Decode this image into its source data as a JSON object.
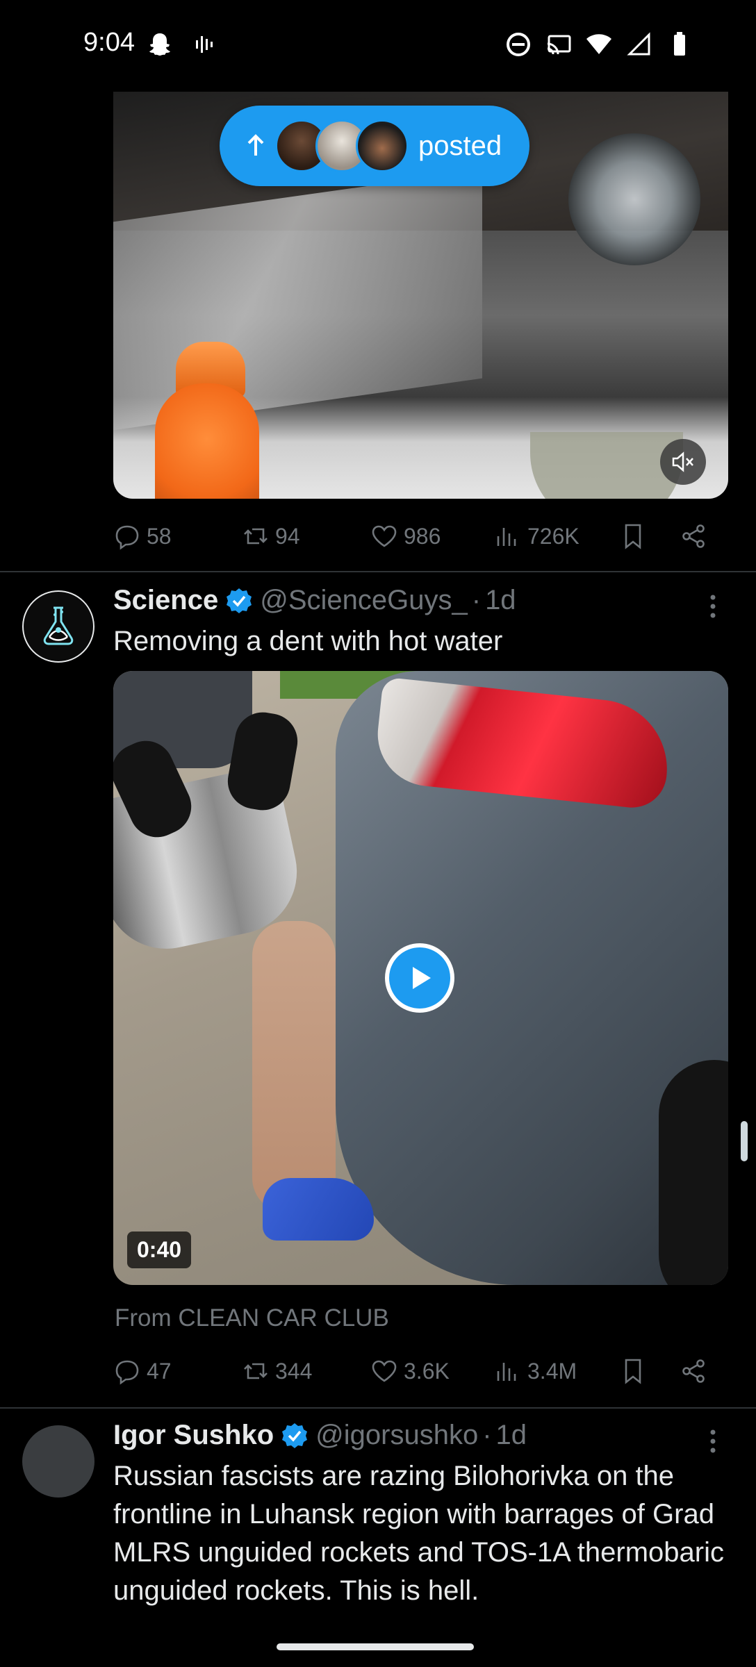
{
  "status_bar": {
    "time": "9:04",
    "left_icons": [
      "snapchat-icon",
      "voice-waveform-icon"
    ],
    "right_icons": [
      "do-not-disturb-icon",
      "cast-icon",
      "wifi-icon",
      "signal-icon",
      "battery-icon"
    ]
  },
  "posted_pill": {
    "label": "posted"
  },
  "tweet1": {
    "actions": {
      "replies": "58",
      "retweets": "94",
      "likes": "986",
      "views": "726K"
    }
  },
  "tweet2": {
    "name": "Science",
    "handle": "@ScienceGuys_",
    "dot": "·",
    "time": "1d",
    "text": "Removing a dent with hot water",
    "video_duration": "0:40",
    "from_prefix": "From",
    "from_source": "CLEAN CAR CLUB",
    "actions": {
      "replies": "47",
      "retweets": "344",
      "likes": "3.6K",
      "views": "3.4M"
    }
  },
  "tweet3": {
    "name": "Igor Sushko",
    "handle": "@igorsushko",
    "dot": "·",
    "time": "1d",
    "text": "Russian fascists are razing Bilohorivka on the frontline in Luhansk region with barrages of Grad MLRS unguided rockets and TOS-1A thermobaric unguided rockets. This is hell."
  },
  "colors": {
    "accent": "#1d9bf0",
    "muted": "#71767b",
    "text": "#e7e9ea",
    "divider": "#2f3336"
  }
}
